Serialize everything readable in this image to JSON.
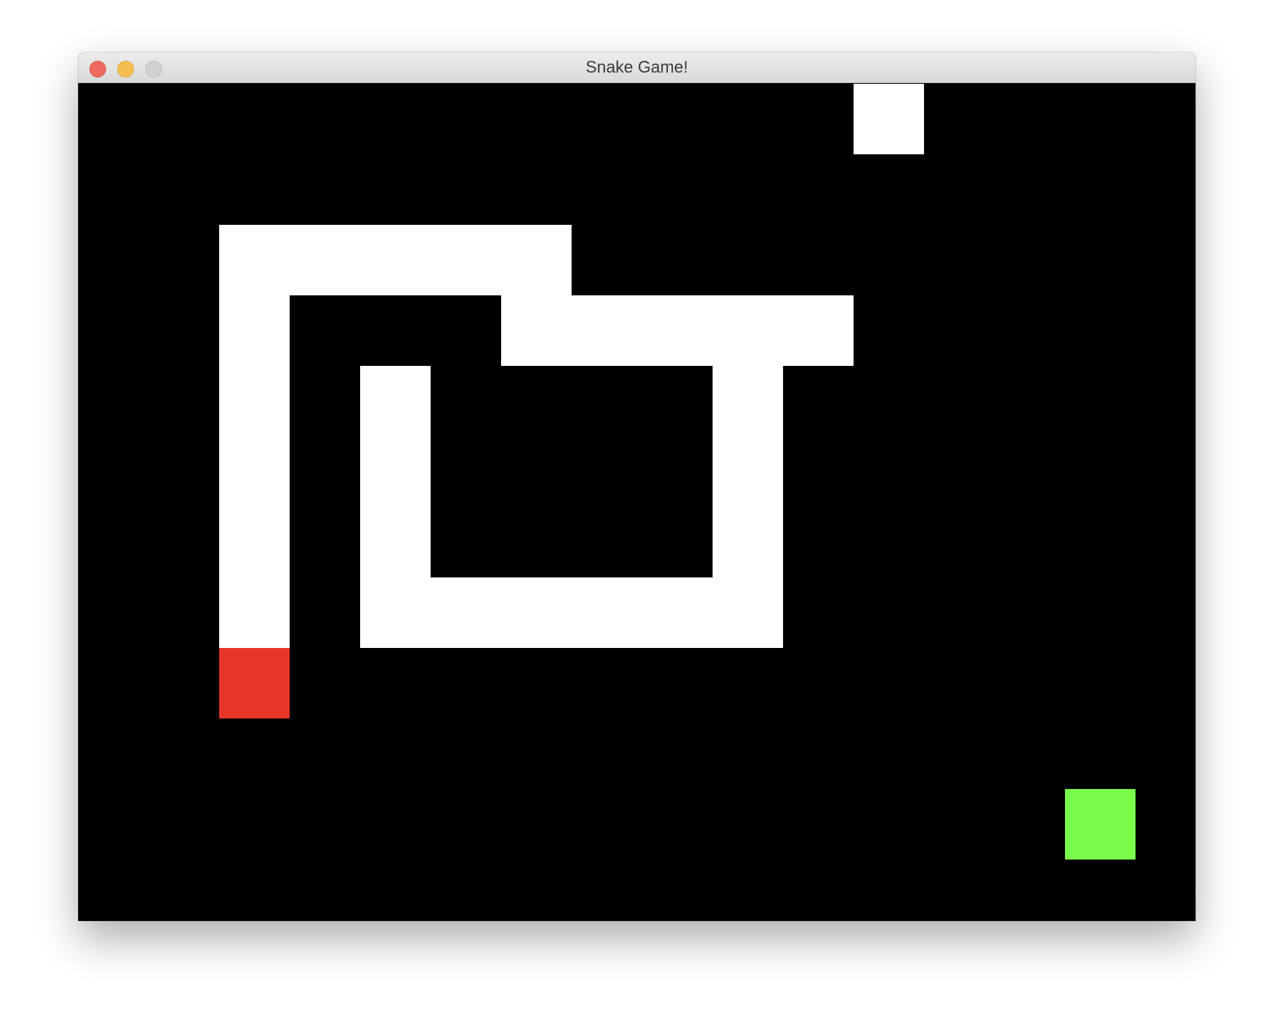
{
  "window": {
    "title": "Snake Game!",
    "buttons": [
      {
        "name": "close",
        "color": "#ed6a5e",
        "border": "#d65a4f"
      },
      {
        "name": "minimize",
        "color": "#f5bf4f",
        "border": "#d9a53e"
      },
      {
        "name": "zoom",
        "color": "#d0d0d0",
        "border": "#bdbdbd"
      }
    ]
  },
  "game": {
    "background_color": "#000000",
    "snake_color": "#ffffff",
    "head_color": "#e8352a",
    "food_color": "#7afb4c",
    "snake_body": [
      [
        11,
        0
      ],
      [
        2,
        2
      ],
      [
        3,
        2
      ],
      [
        4,
        2
      ],
      [
        5,
        2
      ],
      [
        6,
        2
      ],
      [
        2,
        3
      ],
      [
        6,
        3
      ],
      [
        7,
        3
      ],
      [
        8,
        3
      ],
      [
        9,
        3
      ],
      [
        10,
        3
      ],
      [
        2,
        4
      ],
      [
        4,
        4
      ],
      [
        9,
        4
      ],
      [
        2,
        5
      ],
      [
        4,
        5
      ],
      [
        9,
        5
      ],
      [
        2,
        6
      ],
      [
        4,
        6
      ],
      [
        9,
        6
      ],
      [
        2,
        7
      ],
      [
        4,
        7
      ],
      [
        5,
        7
      ],
      [
        6,
        7
      ],
      [
        7,
        7
      ],
      [
        8,
        7
      ],
      [
        9,
        7
      ]
    ],
    "snake_head": [
      2,
      8
    ],
    "food": [
      14,
      10
    ]
  }
}
